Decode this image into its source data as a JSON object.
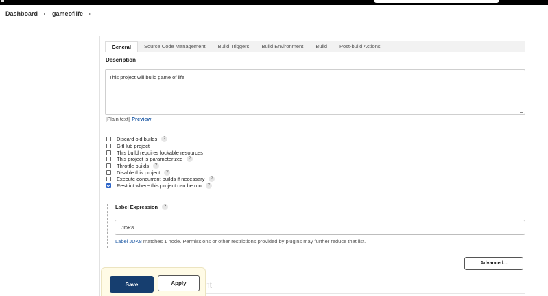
{
  "header": {},
  "breadcrumb": {
    "items": [
      "Dashboard",
      "gameoflife"
    ],
    "separator": "▸"
  },
  "tabs": [
    "General",
    "Source Code Management",
    "Build Triggers",
    "Build Environment",
    "Build",
    "Post-build Actions"
  ],
  "active_tab": "General",
  "general": {
    "description_label": "Description",
    "description_value": "This project will build game of life",
    "format_text": "[Plain text]",
    "preview_link": "Preview"
  },
  "options": [
    {
      "label": "Discard old builds",
      "checked": false,
      "help": true
    },
    {
      "label": "GitHub project",
      "checked": false,
      "help": false
    },
    {
      "label": "This build requires lockable resources",
      "checked": false,
      "help": false
    },
    {
      "label": "This project is parameterized",
      "checked": false,
      "help": true
    },
    {
      "label": "Throttle builds",
      "checked": false,
      "help": true
    },
    {
      "label": "Disable this project",
      "checked": false,
      "help": true
    },
    {
      "label": "Execute concurrent builds if necessary",
      "checked": false,
      "help": true
    },
    {
      "label": "Restrict where this project can be run",
      "checked": true,
      "help": true
    }
  ],
  "help_glyph": "?",
  "label_expression": {
    "title": "Label Expression",
    "value": "JDK8",
    "match_link": "Label JDK8",
    "match_rest": " matches 1 node. Permissions or other restrictions provided by plugins may further reduce that list."
  },
  "advanced_button": "Advanced...",
  "bg_heading_start": "S",
  "bg_heading_end": "nt",
  "actions": {
    "save": "Save",
    "apply": "Apply"
  },
  "colors": {
    "save_bg": "#163e6f",
    "link": "#1f5ba6",
    "checkbox_checked": "#2b64c9",
    "save_bar_bg": "#fffbe6"
  }
}
